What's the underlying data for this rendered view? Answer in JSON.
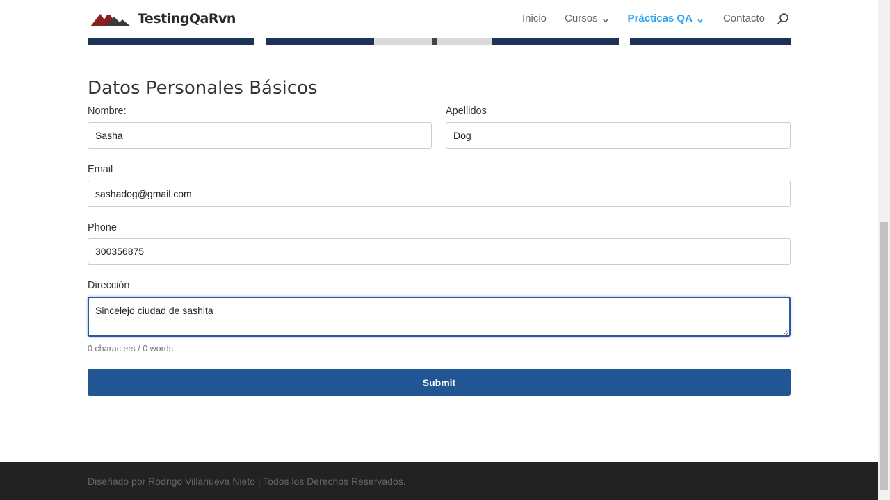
{
  "header": {
    "logo_text": "TestingQaRvn",
    "nav": [
      {
        "label": "Inicio"
      },
      {
        "label": "Cursos"
      },
      {
        "label": "Prácticas QA"
      },
      {
        "label": "Contacto"
      }
    ]
  },
  "form": {
    "title": "Datos Personales Básicos",
    "nombre": {
      "label": "Nombre:",
      "value": "Sasha"
    },
    "apellidos": {
      "label": "Apellidos",
      "value": "Dog"
    },
    "email": {
      "label": "Email",
      "value": "sashadog@gmail.com"
    },
    "phone": {
      "label": "Phone",
      "value": "300356875"
    },
    "direccion": {
      "label": "Dirección",
      "value": "Sincelejo ciudad de sashita"
    },
    "counter": "0 characters / 0 words",
    "submit_label": "Submit"
  },
  "footer": {
    "text": "Diseñado por Rodrigo Villanueva Nieto | Todos los Derechos Reservados."
  },
  "colors": {
    "accent": "#2ea3f2",
    "submit": "#225593",
    "footer": "#222222"
  },
  "icons": {
    "search": "search-icon",
    "chevron": "chevron-down-icon",
    "logo": "mountain-logo-icon"
  }
}
